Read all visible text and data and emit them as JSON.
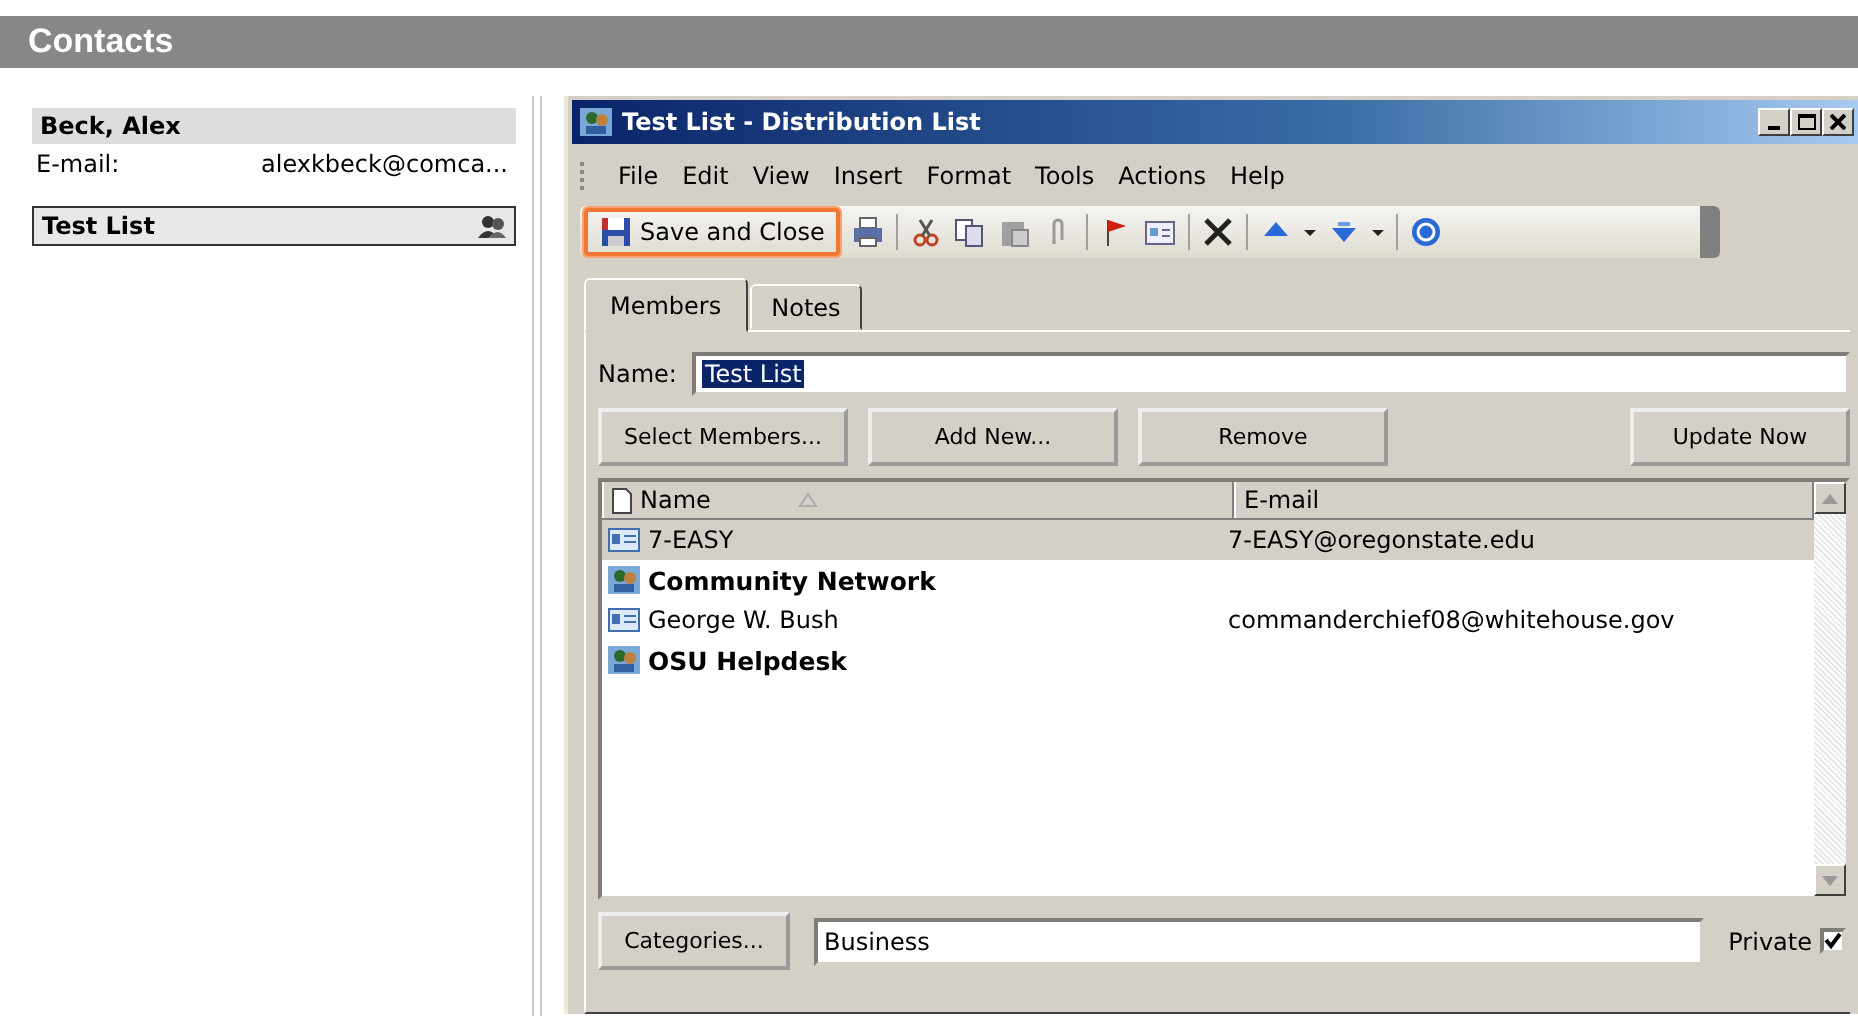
{
  "app_header": {
    "title": "Contacts"
  },
  "contacts": [
    {
      "kind": "card",
      "name": "Beck, Alex",
      "selected": false,
      "fields": [
        {
          "label": "E-mail:",
          "value": "alexkbeck@comca..."
        }
      ]
    },
    {
      "kind": "list",
      "name": "Test List",
      "selected": true
    }
  ],
  "window": {
    "title": "Test List - Distribution List",
    "menu": [
      "File",
      "Edit",
      "View",
      "Insert",
      "Format",
      "Tools",
      "Actions",
      "Help"
    ],
    "save_button": {
      "label": "Save and Close",
      "highlighted": true
    },
    "tabs": [
      {
        "label": "Members",
        "selected": true
      },
      {
        "label": "Notes",
        "selected": false
      }
    ],
    "name_field": {
      "label": "Name:",
      "value": "Test List",
      "text_selected": true
    },
    "buttons": [
      "Select Members...",
      "Add New...",
      "Remove",
      "Update Now"
    ],
    "table": {
      "columns": [
        {
          "label": "Name",
          "sorted": true
        },
        {
          "label": "E-mail",
          "sorted": false
        }
      ],
      "rows": [
        {
          "kind": "contact",
          "name": "7-EASY",
          "email": "7-EASY@oregonstate.edu",
          "selected": true
        },
        {
          "kind": "group",
          "name": "Community Network",
          "selected": false
        },
        {
          "kind": "contact",
          "name": "George W. Bush",
          "email": "commanderchief08@whitehouse.gov",
          "selected": false
        },
        {
          "kind": "group",
          "name": "OSU Helpdesk",
          "selected": false
        }
      ]
    },
    "categories_button": "Categories...",
    "categories_field": {
      "value": "Business"
    },
    "private": {
      "label": "Private",
      "checked": true
    }
  }
}
